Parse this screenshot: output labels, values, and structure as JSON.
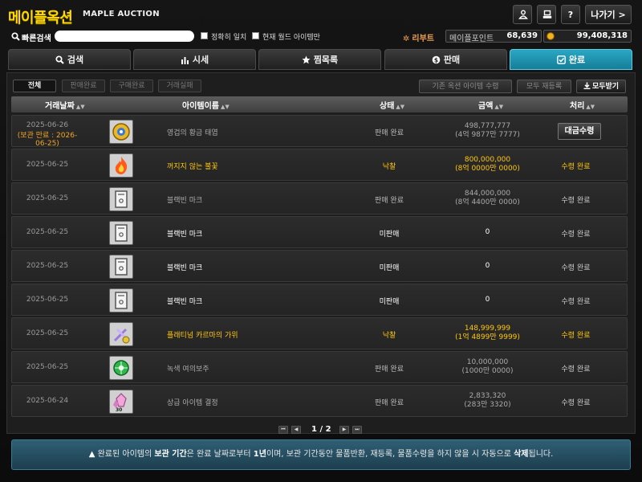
{
  "header": {
    "logo": "메이플옥션",
    "subtitle": "MAPLE AUCTION",
    "exit_label": "나가기 >"
  },
  "search": {
    "label": "빠른검색",
    "placeholder": "",
    "check_exact": "정확히 일치",
    "check_world": "현재 월드 아이템만"
  },
  "world": {
    "name": "리부트"
  },
  "points": {
    "maple_label": "메이플포인트",
    "maple_value": "68,639",
    "meso_value": "99,408,318"
  },
  "tabs": [
    {
      "label": "검색",
      "icon": "search-icon",
      "active": false
    },
    {
      "label": "시세",
      "icon": "chart-icon",
      "active": false
    },
    {
      "label": "찜목록",
      "icon": "star-icon",
      "active": false
    },
    {
      "label": "판매",
      "icon": "coin-icon",
      "active": false
    },
    {
      "label": "완료",
      "icon": "check-icon",
      "active": true
    }
  ],
  "filters": [
    "전체",
    "판매완료",
    "구매완료",
    "거래실패"
  ],
  "actions": {
    "past_items": "기존 옥션 아이템 수령",
    "relist_all": "모두 재등록",
    "receive_all": "모두받기"
  },
  "columns": {
    "date": "거래날짜",
    "item": "아이템이름",
    "status": "상태",
    "amount": "금액",
    "process": "처리"
  },
  "rows": [
    {
      "date": "2025-06-26",
      "expiry": "(보관 만료 : 2026-06-25)",
      "icon": "gold-emblem-icon",
      "name": "영겁의 황금 태엽",
      "name_style": "g",
      "status": "판매 완료",
      "status_style": "g",
      "amount1": "498,777,777",
      "amount2": "(4억 9877만 7777)",
      "amount_style": "g",
      "process": "대금수령",
      "process_type": "button"
    },
    {
      "date": "2025-06-25",
      "expiry": "",
      "icon": "fire-flame-icon",
      "name": "꺼지지 않는 불꽃",
      "name_style": "y",
      "status": "낙찰",
      "status_style": "y",
      "amount1": "800,000,000",
      "amount2": "(8억 0000만 0000)",
      "amount_style": "y",
      "process": "수령 완료",
      "process_type": "y"
    },
    {
      "date": "2025-06-25",
      "expiry": "",
      "icon": "blank-mark-icon",
      "name": "블랙빈 마크",
      "name_style": "g",
      "status": "판매 완료",
      "status_style": "g",
      "amount1": "844,000,000",
      "amount2": "(8억 4400만 0000)",
      "amount_style": "g",
      "process": "수령 완료",
      "process_type": "g"
    },
    {
      "date": "2025-06-25",
      "expiry": "",
      "icon": "blank-mark-icon",
      "name": "블랙빈 마크",
      "name_style": "w",
      "status": "미판매",
      "status_style": "w",
      "amount1": "0",
      "amount2": "",
      "amount_style": "w",
      "process": "수령 완료",
      "process_type": "w"
    },
    {
      "date": "2025-06-25",
      "expiry": "",
      "icon": "blank-mark-icon",
      "name": "블랙빈 마크",
      "name_style": "w",
      "status": "미판매",
      "status_style": "w",
      "amount1": "0",
      "amount2": "",
      "amount_style": "w",
      "process": "수령 완료",
      "process_type": "w"
    },
    {
      "date": "2025-06-25",
      "expiry": "",
      "icon": "blank-mark-icon",
      "name": "블랙빈 마크",
      "name_style": "w",
      "status": "미판매",
      "status_style": "w",
      "amount1": "0",
      "amount2": "",
      "amount_style": "w",
      "process": "수령 완료",
      "process_type": "w"
    },
    {
      "date": "2025-06-25",
      "expiry": "",
      "icon": "purple-karma-icon",
      "name": "플래티넘 카르마의 가위",
      "name_style": "y",
      "status": "낙찰",
      "status_style": "y",
      "amount1": "148,999,999",
      "amount2": "(1억 4899만 9999)",
      "amount_style": "y",
      "process": "수령 완료",
      "process_type": "y"
    },
    {
      "date": "2025-06-25",
      "expiry": "",
      "icon": "green-orb-icon",
      "name": "녹색 여의보주",
      "name_style": "g",
      "status": "판매 완료",
      "status_style": "g",
      "amount1": "10,000,000",
      "amount2": "(1000만 0000)",
      "amount_style": "g",
      "process": "수령 완료",
      "process_type": "g"
    },
    {
      "date": "2025-06-24",
      "expiry": "",
      "icon": "pink-crystal-icon",
      "name": "상급 아이템 결정",
      "name_style": "g",
      "status": "판매 완료",
      "status_style": "g",
      "amount1": "2,833,320",
      "amount2": "(283만 3320)",
      "amount_style": "g",
      "process": "수령 완료",
      "process_type": "g"
    }
  ],
  "pager": {
    "text": "1 / 2"
  },
  "notice": {
    "p1": "완료된 아이템의 ",
    "b1": "보관 기간",
    "p2": "은 완료 날짜로부터 ",
    "b2": "1년",
    "p3": "이며, 보관 기간동안 물품반환, 재등록, 물품수령을 하지 않을 시 자동으로 ",
    "b3": "삭제",
    "p4": "됩니다."
  },
  "colors": {
    "accent": "#1f97b5",
    "gold": "#ffc60a",
    "expiry": "#f5a623"
  }
}
